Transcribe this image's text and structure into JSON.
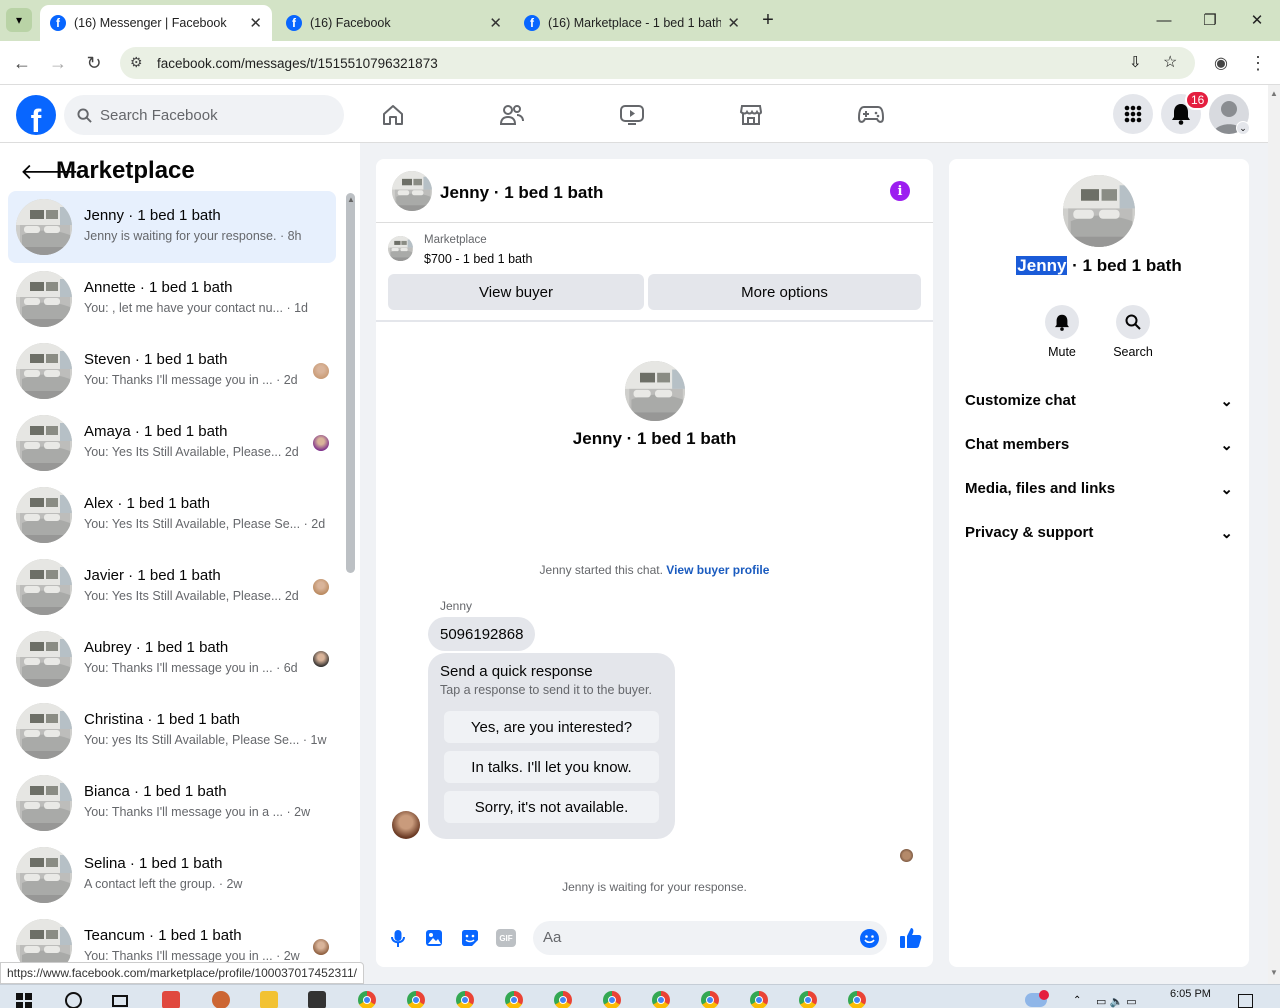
{
  "browser": {
    "tabs": [
      {
        "title": "(16) Messenger | Facebook",
        "active": true
      },
      {
        "title": "(16) Facebook",
        "active": false
      },
      {
        "title": "(16) Marketplace - 1 bed 1 bath",
        "active": false
      }
    ],
    "url": "facebook.com/messages/t/1515510796321873",
    "status_url": "https://www.facebook.com/marketplace/profile/100037017452311/"
  },
  "fb": {
    "search_placeholder": "Search Facebook",
    "notification_count": "16"
  },
  "sidebar": {
    "title": "Marketplace",
    "conversations": [
      {
        "name": "Jenny · 1 bed 1 bath",
        "preview": "Jenny is waiting for your response.",
        "time": "· 8h",
        "selected": true
      },
      {
        "name": "Annette · 1 bed 1 bath",
        "preview": "You: , let me have your contact nu...",
        "time": "· 1d"
      },
      {
        "name": "Steven · 1 bed 1 bath",
        "preview": "You: Thanks I'll message you in ...",
        "time": "· 2d"
      },
      {
        "name": "Amaya · 1 bed 1 bath",
        "preview": "You: Yes Its Still Available, Please...",
        "time": "2d"
      },
      {
        "name": "Alex · 1 bed 1 bath",
        "preview": "You: Yes Its Still Available, Please Se...",
        "time": "· 2d"
      },
      {
        "name": "Javier · 1 bed 1 bath",
        "preview": "You: Yes Its Still Available, Please...",
        "time": "2d"
      },
      {
        "name": "Aubrey · 1 bed 1 bath",
        "preview": "You: Thanks I'll message you in ...",
        "time": "· 6d"
      },
      {
        "name": "Christina · 1 bed 1 bath",
        "preview": "You: yes Its Still Available, Please Se...",
        "time": "· 1w"
      },
      {
        "name": "Bianca · 1 bed 1 bath",
        "preview": "You: Thanks I'll message you in a ...",
        "time": "· 2w"
      },
      {
        "name": "Selina · 1 bed 1 bath",
        "preview": "A contact left the group.",
        "time": "· 2w"
      },
      {
        "name": "Teancum · 1 bed 1 bath",
        "preview": "You: Thanks I'll message you in ...",
        "time": "· 2w"
      }
    ]
  },
  "chat": {
    "header_title": "Jenny · 1 bed 1 bath",
    "listing_label": "Marketplace",
    "listing_title": "$700 - 1 bed 1 bath",
    "view_buyer": "View buyer",
    "more_options": "More options",
    "intro_name": "Jenny · 1 bed 1 bath",
    "started_text": "Jenny started this chat.",
    "buyer_profile_link": "View buyer profile",
    "sender": "Jenny",
    "message": "5096192868",
    "quick_title": "Send a quick response",
    "quick_sub": "Tap a response to send it to the buyer.",
    "quick_replies": [
      "Yes, are you interested?",
      "In talks. I'll let you know.",
      "Sorry, it's not available."
    ],
    "waiting_text": "Jenny is waiting for your response.",
    "composer_placeholder": "Aa"
  },
  "info": {
    "name_highlight": "Jenny",
    "name_rest": " · 1 bed 1 bath",
    "mute": "Mute",
    "search": "Search",
    "sections": [
      "Customize chat",
      "Chat members",
      "Media, files and links",
      "Privacy & support"
    ]
  },
  "taskbar": {
    "time": "6:05 PM"
  },
  "colors": {
    "fb_blue": "#0866ff",
    "link_blue": "#1a5bbf",
    "purple_info": "#9c1ef0",
    "badge_red": "#e41e3f"
  }
}
